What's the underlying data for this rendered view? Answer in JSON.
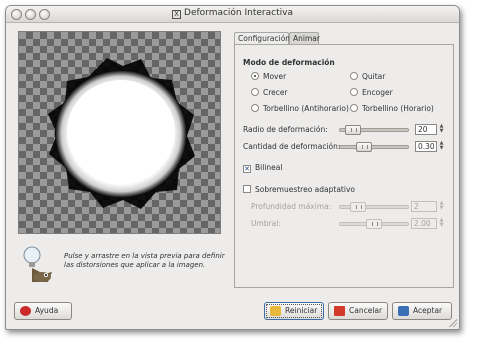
{
  "window": {
    "title": "Deformación Interactiva"
  },
  "hint": {
    "text": "Pulse y arrastre en la vista previa para definir las distorsiones que aplicar a la imagen."
  },
  "tabs": [
    {
      "label": "Configuración",
      "active": true
    },
    {
      "label": "Animar",
      "active": false
    }
  ],
  "mode": {
    "title": "Modo de deformación",
    "options": [
      {
        "label": "Mover",
        "selected": true
      },
      {
        "label": "Quitar",
        "selected": false
      },
      {
        "label": "Crecer",
        "selected": false
      },
      {
        "label": "Encoger",
        "selected": false
      },
      {
        "label": "Torbellino (Antihorario)",
        "selected": false
      },
      {
        "label": "Torbellino (Horario)",
        "selected": false
      }
    ]
  },
  "radius": {
    "label": "Radio de deformación:",
    "value": "20",
    "level": 0.1
  },
  "amount": {
    "label": "Cantidad de deformación:",
    "value": "0.30",
    "level": 0.3
  },
  "bilinear": {
    "label": "Bilineal",
    "checked": true
  },
  "supersample": {
    "label": "Sobremuestreo adaptativo",
    "checked": false,
    "depth": {
      "label": "Profundidad máxima:",
      "value": "2",
      "level": 0.2
    },
    "threshold": {
      "label": "Umbral:",
      "value": "2.00",
      "level": 0.5
    }
  },
  "buttons": {
    "help": "Ayuda",
    "reset": "Reiniciar",
    "cancel": "Cancelar",
    "ok": "Aceptar"
  }
}
